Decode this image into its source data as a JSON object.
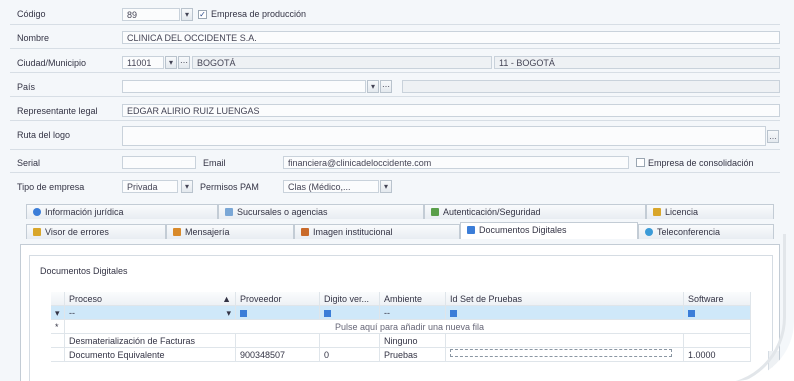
{
  "form": {
    "codigo_label": "Código",
    "codigo_value": "89",
    "empresa_produccion_label": "Empresa de producción",
    "empresa_produccion_checked": true,
    "nombre_label": "Nombre",
    "nombre_value": "CLINICA DEL OCCIDENTE S.A.",
    "ciudad_label": "Ciudad/Municipio",
    "ciudad_code": "11001",
    "ciudad_name": "BOGOTÁ",
    "ciudad_full": "11 - BOGOTÁ",
    "pais_label": "País",
    "pais_value": "",
    "representante_label": "Representante legal",
    "representante_value": "EDGAR ALIRIO RUIZ LUENGAS",
    "ruta_logo_label": "Ruta del logo",
    "ruta_logo_value": "",
    "serial_label": "Serial",
    "serial_value": "",
    "email_label": "Email",
    "email_value": "financiera@clinicadeloccidente.com",
    "empresa_consolidacion_label": "Empresa de consolidación",
    "tipo_empresa_label": "Tipo de empresa",
    "tipo_empresa_value": "Privada",
    "permisos_label": "Permisos PAM",
    "permisos_value": "Clas (Médico,..."
  },
  "tabs_row1": [
    {
      "label": "Información jurídica",
      "color": "#3b7dd8"
    },
    {
      "label": "Sucursales o agencias",
      "color": "#7aa7d6"
    },
    {
      "label": "Autenticación/Seguridad",
      "color": "#5a9f4a"
    },
    {
      "label": "Licencia",
      "color": "#d9a62a"
    }
  ],
  "tabs_row2": [
    {
      "label": "Visor de errores",
      "color": "#d9a62a"
    },
    {
      "label": "Mensajería",
      "color": "#d98a2a"
    },
    {
      "label": "Imagen institucional",
      "color": "#c96a2a"
    },
    {
      "label": "Documentos Digitales",
      "color": "#3b7dd8"
    },
    {
      "label": "Teleconferencia",
      "color": "#3b9bd8"
    }
  ],
  "documentos": {
    "group_title": "Documentos Digitales",
    "columns": [
      "Proceso",
      "Proveedor",
      "Digito ver...",
      "Ambiente",
      "Id Set de Pruebas",
      "Software"
    ],
    "filter_row": [
      "--",
      "",
      "",
      "--",
      "",
      ""
    ],
    "new_row_hint": "Pulse aquí para añadir una nueva fila",
    "rows": [
      [
        "Desmaterialización de Facturas",
        "",
        "",
        "Ninguno",
        "",
        ""
      ],
      [
        "Documento Equivalente",
        "900348507",
        "0",
        "Pruebas",
        "",
        "1.0000"
      ]
    ]
  }
}
